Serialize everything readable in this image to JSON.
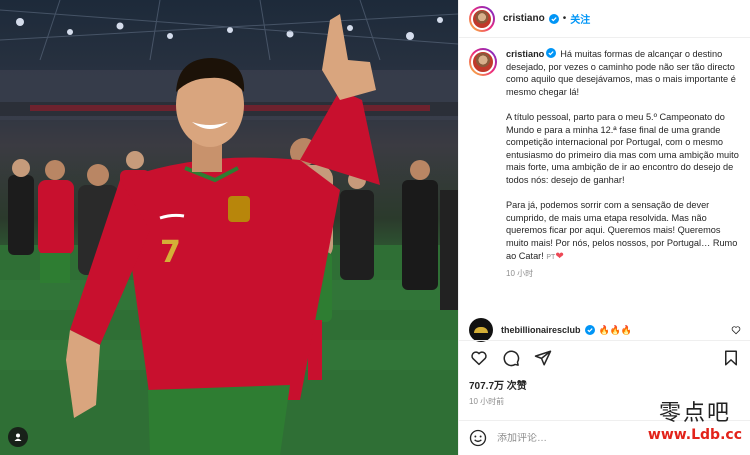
{
  "post": {
    "username": "cristiano",
    "follow_label": "关注",
    "dot": "•",
    "caption": {
      "p1": "Há muitas formas de alcançar o destino desejado, por vezes o caminho pode não ser tão directo como aquilo que desejávamos, mas o mais importante é mesmo chegar lá!",
      "p2": "A título pessoal, parto para o meu 5.º Campeonato do Mundo e para a minha 12.ª fase final de uma grande competição internacional por Portugal, com o mesmo entusiasmo do primeiro dia mas com uma ambição muito mais forte, uma ambição de ir ao encontro do desejo de todos nós: desejo de ganhar!",
      "p3": "Para já, podemos sorrir com a sensação de dever cumprido, de mais uma etapa resolvida. Mas não queremos ficar por aqui. Queremos mais! Queremos muito mais! Por nós, pelos nossos, por Portugal… Rumo ao Catar!",
      "lang_tag": "PT",
      "heart": "❤",
      "time": "10 小时"
    },
    "top_comment": {
      "username": "thebillionairesclub",
      "text": "🔥🔥🔥"
    },
    "likes": "707.7万 次赞",
    "time": "10 小时前",
    "comment_placeholder": "添加评论…"
  },
  "watermark": {
    "cn": "零点吧",
    "url": "www.Ldb.cc"
  },
  "icons": {
    "verified": "verified-badge-icon",
    "like": "heart-icon",
    "comment": "comment-icon",
    "share": "send-icon",
    "save": "bookmark-icon",
    "emoji": "emoji-icon",
    "user_tag": "user-tag-icon"
  },
  "colors": {
    "verified_blue": "#0095f6",
    "link_blue": "#0095f6",
    "like_red": "#ed4956",
    "jersey_red": "#c8102e",
    "jersey_green": "#2e7d32",
    "watermark_red": "#e2231a"
  }
}
